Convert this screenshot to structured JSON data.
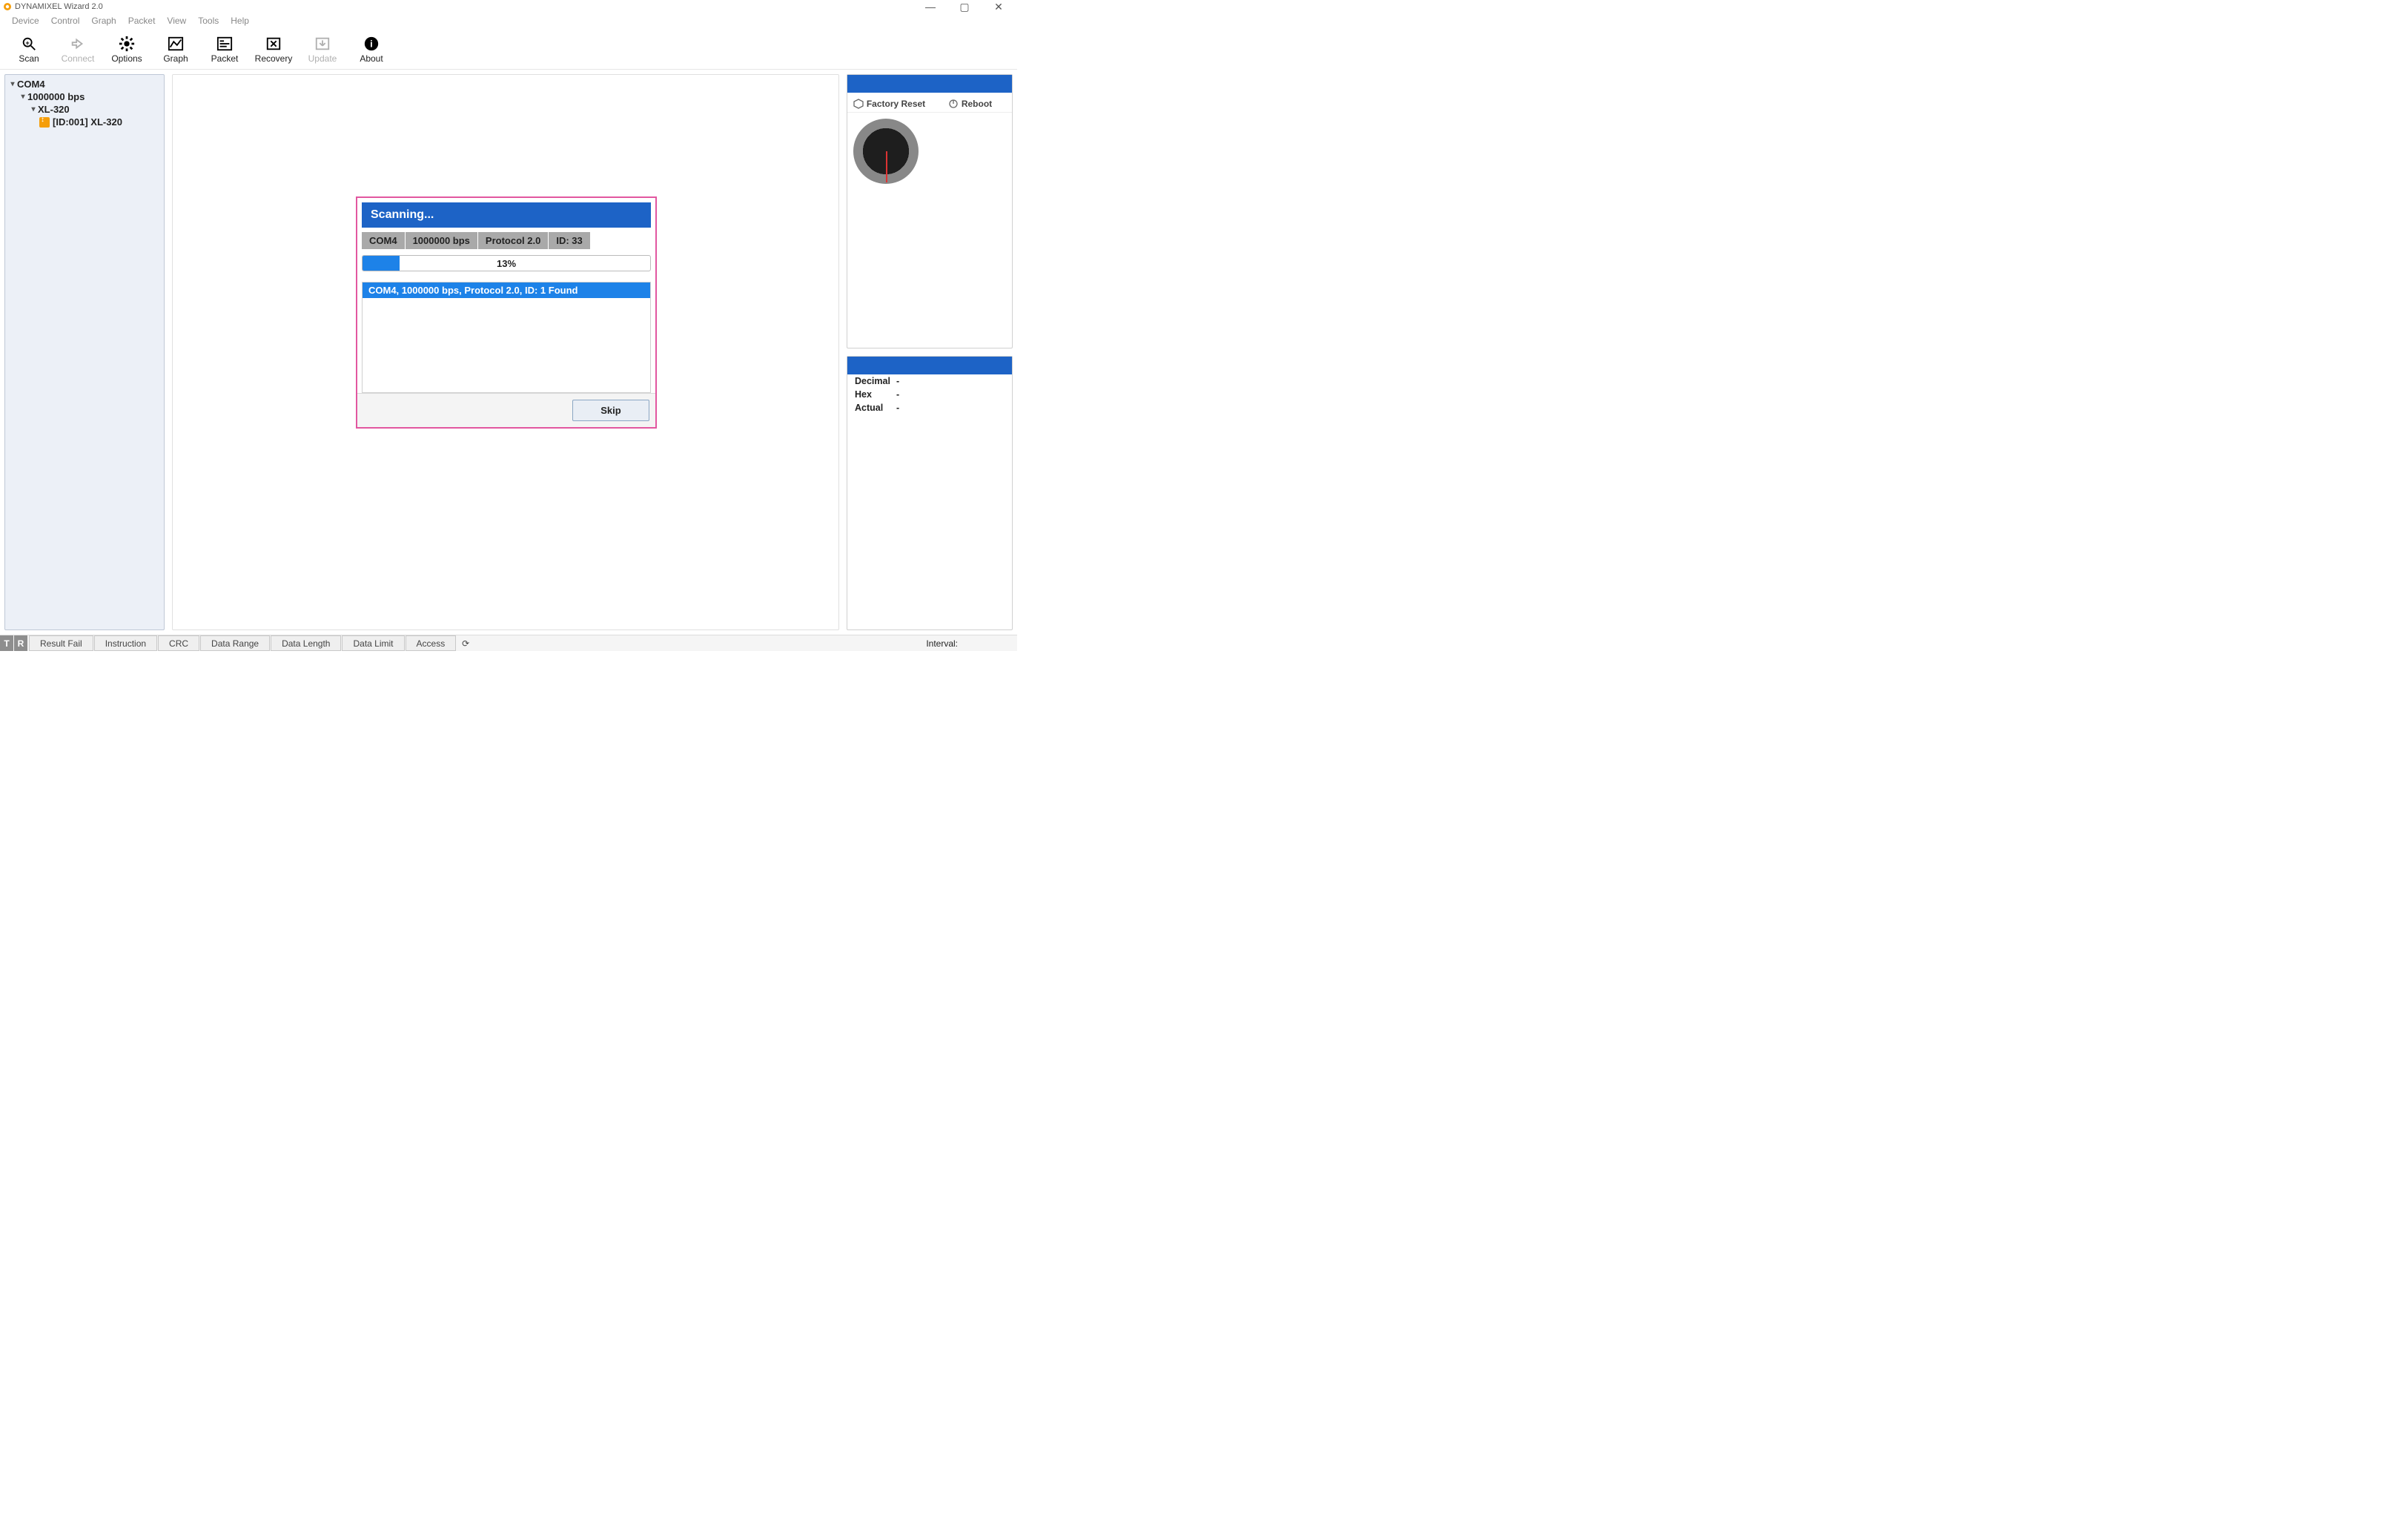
{
  "window": {
    "title": "DYNAMIXEL Wizard 2.0"
  },
  "menu": {
    "items": [
      "Device",
      "Control",
      "Graph",
      "Packet",
      "View",
      "Tools",
      "Help"
    ]
  },
  "toolbar": {
    "scan": "Scan",
    "connect": "Connect",
    "options": "Options",
    "graph": "Graph",
    "packet": "Packet",
    "recovery": "Recovery",
    "update": "Update",
    "about": "About"
  },
  "tree": {
    "port": "COM4",
    "baud": "1000000 bps",
    "model": "XL-320",
    "device": "[ID:001] XL-320"
  },
  "right": {
    "factory_reset": "Factory Reset",
    "reboot": "Reboot",
    "value_labels": {
      "decimal": "Decimal",
      "hex": "Hex",
      "actual": "Actual"
    },
    "value_values": {
      "decimal": "-",
      "hex": "-",
      "actual": "-"
    }
  },
  "modal": {
    "title": "Scanning...",
    "tags": {
      "port": "COM4",
      "baud": "1000000 bps",
      "protocol": "Protocol 2.0",
      "id": "ID: 33"
    },
    "progress_pct": 13,
    "progress_label": "13%",
    "found_text": "COM4, 1000000 bps, Protocol 2.0, ID: 1 Found",
    "skip": "Skip"
  },
  "statusbar": {
    "tx": "T",
    "rx": "R",
    "cells": [
      "Result Fail",
      "Instruction",
      "CRC",
      "Data Range",
      "Data Length",
      "Data Limit",
      "Access"
    ],
    "interval_label": "Interval:"
  }
}
